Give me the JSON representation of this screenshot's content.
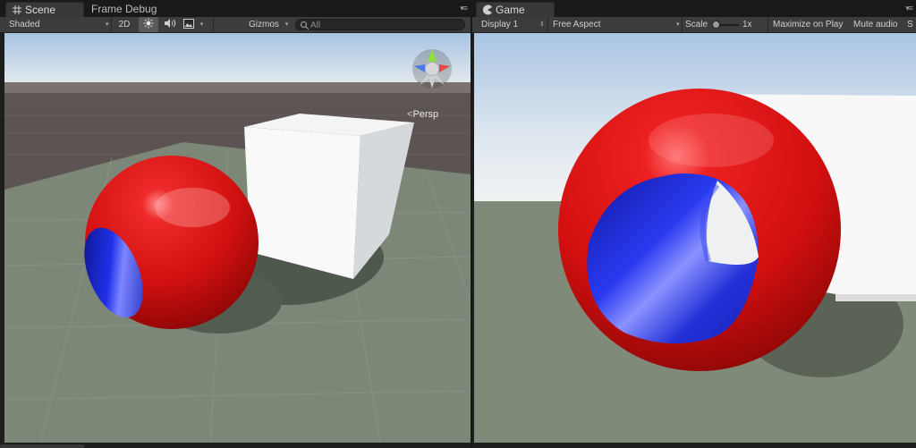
{
  "scene": {
    "tabs": [
      {
        "label": "Scene",
        "active": true
      },
      {
        "label": "Frame Debug",
        "active": false
      }
    ],
    "toolbar": {
      "shading_mode": "Shaded",
      "mode_2d": "2D",
      "gizmos": "Gizmos",
      "search_placeholder": "All"
    },
    "projection_label": "Persp"
  },
  "game": {
    "tab": {
      "label": "Game",
      "active": true
    },
    "toolbar": {
      "display": "Display 1",
      "aspect": "Free Aspect",
      "scale_label": "Scale",
      "scale_value": "1x",
      "maximize": "Maximize on Play",
      "mute": "Mute audio",
      "stats_cut": "S"
    }
  },
  "icons": {
    "scene_tab": "grid-hash-icon",
    "game_tab": "pacman-icon",
    "lighting": "sun-icon",
    "audio": "speaker-icon",
    "effects": "image-icon",
    "search": "search-icon"
  },
  "colors": {
    "sphere_red": "#d21010",
    "sphere_inner_blue": "#1a23d8",
    "ground": "#7d8778",
    "sky_top": "#a7c3e1",
    "accent_toggle": "#5a5a5a"
  }
}
